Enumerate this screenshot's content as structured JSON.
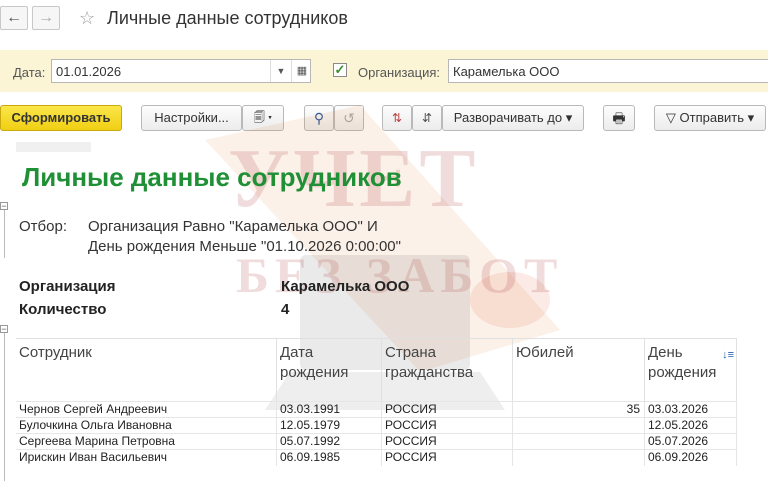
{
  "window": {
    "title": "Личные данные сотрудников",
    "back_icon": "arrow-left-icon",
    "forward_icon": "arrow-right-icon",
    "favorite_icon": "star-icon"
  },
  "filters": {
    "date_label": "Дата:",
    "date_value": "01.01.2026",
    "org_checkbox_checked": true,
    "org_label": "Организация:",
    "org_value": "Карамелька ООО"
  },
  "toolbar": {
    "generate_label": "Сформировать",
    "settings_label": "Настройки...",
    "expand_to_label": "Разворачивать до",
    "send_label": "Отправить",
    "colors": {
      "primary_button": "#f0cf13"
    }
  },
  "report": {
    "title": "Личные данные сотрудников",
    "title_color": "#1f9035",
    "selection_label": "Отбор:",
    "selection_line1": "Организация Равно \"Карамелька ООО\" И",
    "selection_line2": "День рождения Меньше \"01.10.2026 0:00:00\"",
    "org_key": "Организация",
    "org_val": "Карамелька ООО",
    "count_key": "Количество",
    "count_val": "4",
    "columns": {
      "employee": "Сотрудник",
      "birth_date": "Дата рождения",
      "country": "Страна гражданства",
      "jubilee": "Юбилей",
      "birthday": "День рождения"
    },
    "rows": [
      {
        "employee": "Чернов Сергей Андреевич",
        "birth_date": "03.03.1991",
        "country": "РОССИЯ",
        "jubilee": "35",
        "birthday": "03.03.2026"
      },
      {
        "employee": "Булочкина Ольга Ивановна",
        "birth_date": "12.05.1979",
        "country": "РОССИЯ",
        "jubilee": "",
        "birthday": "12.05.2026"
      },
      {
        "employee": "Сергеева Марина Петровна",
        "birth_date": "05.07.1992",
        "country": "РОССИЯ",
        "jubilee": "",
        "birthday": "05.07.2026"
      },
      {
        "employee": "Ирискин Иван Васильевич",
        "birth_date": "06.09.1985",
        "country": "РОССИЯ",
        "jubilee": "",
        "birthday": "06.09.2026"
      }
    ]
  },
  "watermark": {
    "line1": "УЧЕТ",
    "line2": "БЕЗ ЗАБОТ"
  }
}
